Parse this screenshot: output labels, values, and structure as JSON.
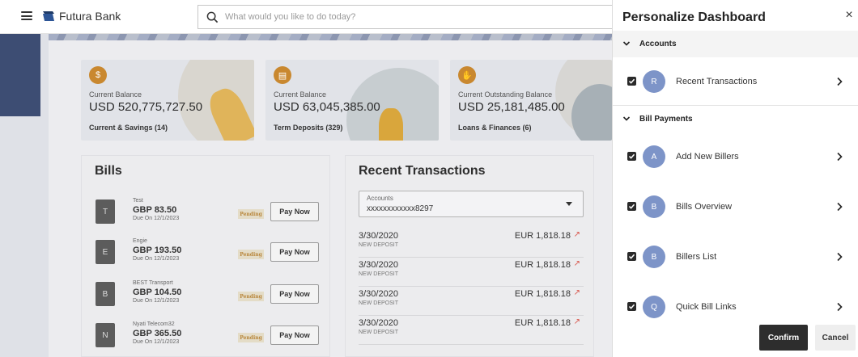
{
  "header": {
    "brand": "Futura Bank",
    "search_placeholder": "What would you like to do today?"
  },
  "summary_cards": [
    {
      "label": "Current Balance",
      "value": "USD 520,775,727.50",
      "link": "Current & Savings (14)",
      "icon": "dollar-coin-icon"
    },
    {
      "label": "Current Balance",
      "value": "USD 63,045,385.00",
      "link": "Term Deposits (329)",
      "icon": "document-icon"
    },
    {
      "label": "Current Outstanding Balance",
      "value": "USD 25,181,485.00",
      "link": "Loans & Finances (6)",
      "icon": "loan-hand-icon"
    }
  ],
  "bills": {
    "title": "Bills",
    "items": [
      {
        "initial": "T",
        "name": "Test",
        "amount": "GBP 83.50",
        "due": "Due On 12/1/2023",
        "status": "Pending",
        "action": "Pay Now"
      },
      {
        "initial": "E",
        "name": "Engie",
        "amount": "GBP 193.50",
        "due": "Due On 12/1/2023",
        "status": "Pending",
        "action": "Pay Now"
      },
      {
        "initial": "B",
        "name": "BEST Transport",
        "amount": "GBP 104.50",
        "due": "Due On 12/1/2023",
        "status": "Pending",
        "action": "Pay Now"
      },
      {
        "initial": "N",
        "name": "Nyati Telecom32",
        "amount": "GBP 365.50",
        "due": "Due On 12/1/2023",
        "status": "Pending",
        "action": "Pay Now"
      }
    ]
  },
  "recent_transactions": {
    "title": "Recent Transactions",
    "account_label": "Accounts",
    "account_value": "xxxxxxxxxxxx8297",
    "items": [
      {
        "date": "3/30/2020",
        "type": "NEW DEPOSIT",
        "amount": "EUR 1,818.18"
      },
      {
        "date": "3/30/2020",
        "type": "NEW DEPOSIT",
        "amount": "EUR 1,818.18"
      },
      {
        "date": "3/30/2020",
        "type": "NEW DEPOSIT",
        "amount": "EUR 1,818.18"
      },
      {
        "date": "3/30/2020",
        "type": "NEW DEPOSIT",
        "amount": "EUR 1,818.18"
      }
    ]
  },
  "drawer": {
    "title": "Personalize Dashboard",
    "close": "×",
    "sections": [
      {
        "label": "Accounts",
        "widgets": [
          {
            "initial": "R",
            "label": "Recent Transactions",
            "checked": true
          }
        ]
      },
      {
        "label": "Bill Payments",
        "widgets": [
          {
            "initial": "A",
            "label": "Add New Billers",
            "checked": true
          },
          {
            "initial": "B",
            "label": "Bills Overview",
            "checked": true
          },
          {
            "initial": "B",
            "label": "Billers List",
            "checked": true
          },
          {
            "initial": "Q",
            "label": "Quick Bill Links",
            "checked": true
          }
        ]
      }
    ],
    "confirm": "Confirm",
    "cancel": "Cancel"
  },
  "colors": {
    "accent_orange": "#c9882f",
    "avatar_blue": "#7d94c8",
    "primary_button": "#2d2d2d",
    "pending_text": "#b8863b"
  }
}
